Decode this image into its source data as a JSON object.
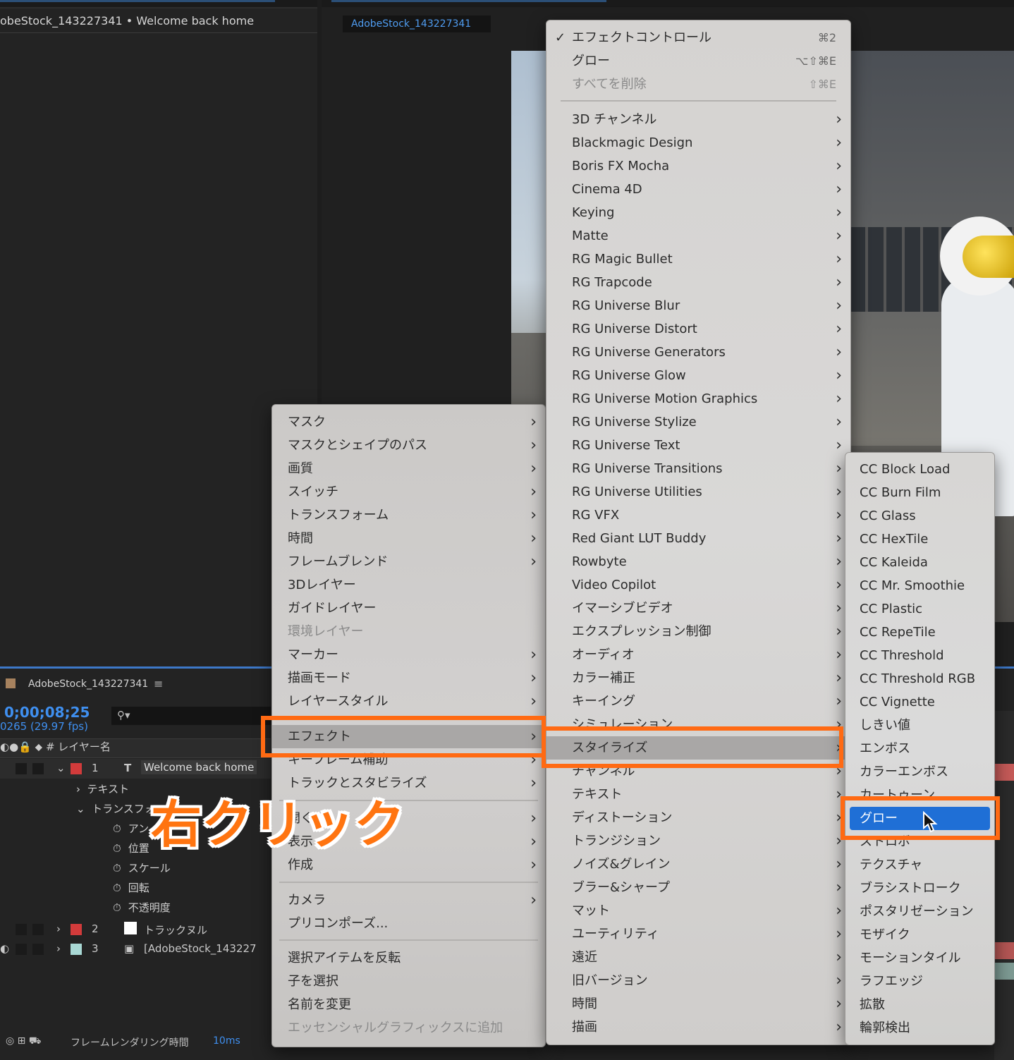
{
  "effect_controls_panel": {
    "title": "obeStock_143227341 • Welcome back home"
  },
  "composition_panel": {
    "tab": "AdobeStock_143227341"
  },
  "timeline": {
    "title": "AdobeStock_143227341",
    "menu_icon": "≡",
    "timecode": "0;00;08;25",
    "frames": "0265 (29.97 fps)",
    "search_glyph": "⚲▾",
    "header": {
      "number": "#",
      "layer_name": "レイヤー名"
    },
    "layers": [
      {
        "index": "1",
        "type_glyph": "T",
        "name": "Welcome back home",
        "label_color": "#d23b3b"
      },
      {
        "index": "2",
        "type_glyph": "",
        "name": "トラックヌル",
        "label_color": "#d23b3b"
      },
      {
        "index": "3",
        "type_glyph": "▣",
        "name": "[AdobeStock_143227",
        "label_color": "#a8d8d4"
      }
    ],
    "groups": {
      "text": "テキスト",
      "transform": "トランスフォ"
    },
    "properties": [
      "アン",
      "位置",
      "スケール",
      "回転",
      "不透明度"
    ],
    "footer": {
      "label": "フレームレンダリング時間",
      "value": "10ms"
    }
  },
  "context_menu": {
    "items": [
      {
        "label": "マスク",
        "submenu": true
      },
      {
        "label": "マスクとシェイプのパス",
        "submenu": true
      },
      {
        "label": "画質",
        "submenu": true
      },
      {
        "label": "スイッチ",
        "submenu": true
      },
      {
        "label": "トランスフォーム",
        "submenu": true
      },
      {
        "label": "時間",
        "submenu": true
      },
      {
        "label": "フレームブレンド",
        "submenu": true
      },
      {
        "label": "3Dレイヤー",
        "submenu": false
      },
      {
        "label": "ガイドレイヤー",
        "submenu": false
      },
      {
        "label": "環境レイヤー",
        "submenu": false,
        "disabled": true
      },
      {
        "label": "マーカー",
        "submenu": true
      },
      {
        "label": "描画モード",
        "submenu": true
      },
      {
        "label": "レイヤースタイル",
        "submenu": true
      },
      {
        "label": "エフェクト",
        "submenu": true,
        "highlighted": true
      },
      {
        "label": "キーフレーム補助",
        "submenu": true
      },
      {
        "label": "トラックとスタビライズ",
        "submenu": true
      },
      {
        "label": "開く",
        "submenu": true
      },
      {
        "label": "表示",
        "submenu": true
      },
      {
        "label": "作成",
        "submenu": true
      },
      {
        "label": "カメラ",
        "submenu": true
      },
      {
        "label": "プリコンポーズ...",
        "submenu": false
      },
      {
        "label": "選択アイテムを反転",
        "submenu": false
      },
      {
        "label": "子を選択",
        "submenu": false
      },
      {
        "label": "名前を変更",
        "submenu": false
      },
      {
        "label": "エッセンシャルグラフィックスに追加",
        "submenu": false,
        "disabled": true
      }
    ]
  },
  "effects_menu": {
    "top_items": [
      {
        "label": "エフェクトコントロール",
        "shortcut": "⌘2",
        "checked": true
      },
      {
        "label": "グロー",
        "shortcut": "⌥⇧⌘E"
      },
      {
        "label": "すべてを削除",
        "shortcut": "⇧⌘E",
        "disabled": true
      }
    ],
    "categories": [
      "3D チャンネル",
      "Blackmagic Design",
      "Boris FX Mocha",
      "Cinema 4D",
      "Keying",
      "Matte",
      "RG Magic Bullet",
      "RG Trapcode",
      "RG Universe Blur",
      "RG Universe Distort",
      "RG Universe Generators",
      "RG Universe Glow",
      "RG Universe Motion Graphics",
      "RG Universe Stylize",
      "RG Universe Text",
      "RG Universe Transitions",
      "RG Universe Utilities",
      "RG VFX",
      "Red Giant LUT Buddy",
      "Rowbyte",
      "Video Copilot",
      "イマーシブビデオ",
      "エクスプレッション制御",
      "オーディオ",
      "カラー補正",
      "キーイング",
      "シミュレーション",
      "スタイライズ",
      "チャンネル",
      "テキスト",
      "ディストーション",
      "トランジション",
      "ノイズ&グレイン",
      "ブラー&シャープ",
      "マット",
      "ユーティリティ",
      "遠近",
      "旧バージョン",
      "時間",
      "描画"
    ],
    "highlighted": "スタイライズ"
  },
  "stylize_menu": {
    "items": [
      "CC Block Load",
      "CC Burn Film",
      "CC Glass",
      "CC HexTile",
      "CC Kaleida",
      "CC Mr. Smoothie",
      "CC Plastic",
      "CC RepeTile",
      "CC Threshold",
      "CC Threshold RGB",
      "CC Vignette",
      "しきい値",
      "エンボス",
      "カラーエンボス",
      "カートゥーン",
      "グロー",
      "ストロボ",
      "テクスチャ",
      "ブラシストローク",
      "ポスタリゼーション",
      "モザイク",
      "モーションタイル",
      "ラフエッジ",
      "拡散",
      "輪郭検出"
    ],
    "selected": "グロー"
  },
  "annotation": {
    "callout": "右クリック",
    "accent": "#ff6a13"
  },
  "icons": {
    "submenu": "chevron-right-icon",
    "check": "checkmark-icon",
    "stopwatch": "stopwatch-icon",
    "cursor": "mouse-pointer-icon"
  }
}
